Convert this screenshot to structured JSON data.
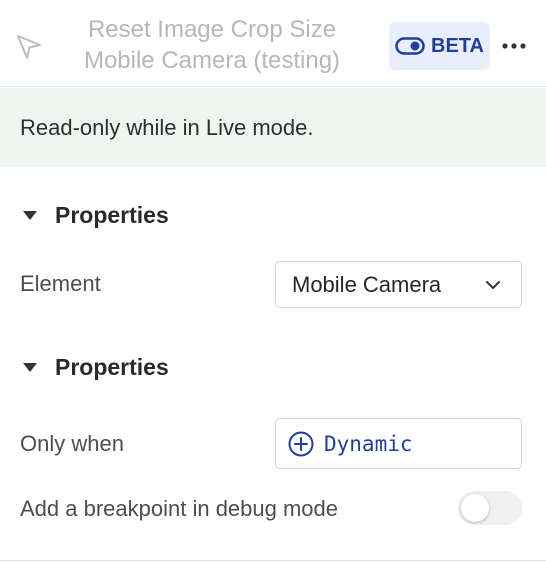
{
  "header": {
    "title": "Reset Image Crop Size Mobile Camera (testing)",
    "beta_label": "BETA",
    "cursor_icon": "cursor-arrow-icon",
    "more_icon": "more-dots-icon"
  },
  "notice": {
    "text": "Read-only while in Live mode."
  },
  "properties_1": {
    "heading": "Properties",
    "element_label": "Element",
    "element_value": "Mobile Camera"
  },
  "properties_2": {
    "heading": "Properties",
    "only_when_label": "Only when",
    "only_when_value": "Dynamic",
    "breakpoint_label": "Add a breakpoint in debug mode",
    "breakpoint_enabled": false
  },
  "colors": {
    "accent": "#1f3f9b",
    "beta_bg": "#e8eefc",
    "notice_bg": "#eef6f1"
  }
}
